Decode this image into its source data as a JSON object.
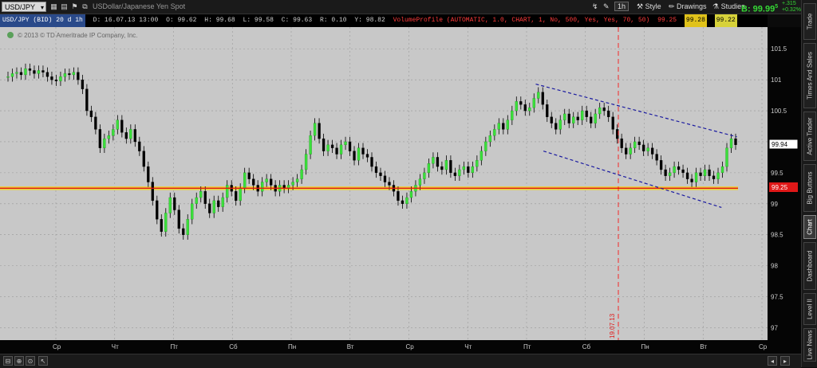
{
  "toolbar": {
    "symbol": "USD/JPY",
    "description": "USDollar/Japanese Yen Spot",
    "period": "1h",
    "style_label": "Style",
    "drawings_label": "Drawings",
    "studies_label": "Studies",
    "bid_label": "B: 99.99",
    "bid_superscript": "5",
    "change_pos": "+.315",
    "change_pct": "+0.32%"
  },
  "infobar": {
    "symbol_tag": "USD/JPY (BID) 20 d 1h",
    "date": "D: 16.07.13 13:00",
    "open": "O: 99.62",
    "high": "H: 99.68",
    "low": "L: 99.58",
    "close": "C: 99.63",
    "range": "R: 0.10",
    "y": "Y: 98.82",
    "volume_profile": "VolumeProfile (AUTOMATIC, 1.0, CHART, 1, No, 500, Yes, Yes, 70, 50)",
    "vp_value1": "99.25",
    "vp_value2": "99.28",
    "vp_value3": "99.22"
  },
  "copyright": "© 2013 © TD Ameritrade IP Company, Inc.",
  "sidebar_tabs": [
    "Trade",
    "Times And Sales",
    "Active Trader",
    "Big Buttons",
    "Chart",
    "Dashboard",
    "Level II",
    "Live News"
  ],
  "active_tab": "Chart",
  "price_labels": {
    "current": "99.94",
    "level": "99.25"
  },
  "vertical_line_label": "19.07.13",
  "colors": {
    "background": "#c8c8c8",
    "up": "#3ae03a",
    "down": "#000000",
    "grid": "#999999",
    "level_line": "#e01818",
    "channel": "#1a1aa0",
    "vline": "#ff0000"
  },
  "chart_data": {
    "type": "candlestick",
    "y_ticks": [
      101.5,
      101,
      100.5,
      100,
      99.5,
      99,
      98.5,
      98,
      97.5,
      97
    ],
    "ylim": [
      96.8,
      101.85
    ],
    "x_ticks": [
      "Ср",
      "Чт",
      "Пт",
      "Сб",
      "Пн",
      "Вт",
      "Ср",
      "Чт",
      "Пт",
      "Сб",
      "Пн",
      "Вт",
      "Ср"
    ],
    "horizontal_level": 99.25,
    "current_price": 99.94,
    "vertical_marker": "19.07.13",
    "channel": {
      "upper": [
        [
          0.698,
          100.93
        ],
        [
          0.96,
          100.08
        ]
      ],
      "lower": [
        [
          0.708,
          99.85
        ],
        [
          0.94,
          98.94
        ]
      ]
    },
    "closes": [
      101.05,
      101.1,
      101.12,
      101.08,
      101.18,
      101.15,
      101.1,
      101.15,
      101.12,
      101.05,
      101.0,
      100.98,
      101.05,
      101.1,
      101.08,
      101.12,
      101.0,
      100.85,
      100.5,
      100.4,
      100.2,
      99.9,
      100.05,
      100.1,
      100.2,
      100.35,
      100.15,
      100.05,
      100.2,
      100.0,
      99.85,
      99.6,
      99.35,
      99.05,
      98.75,
      98.55,
      98.85,
      99.1,
      98.9,
      98.6,
      98.5,
      98.75,
      99.0,
      99.1,
      99.2,
      99.0,
      98.85,
      99.05,
      98.95,
      99.1,
      99.3,
      99.2,
      99.05,
      99.25,
      99.5,
      99.4,
      99.3,
      99.2,
      99.35,
      99.4,
      99.3,
      99.2,
      99.3,
      99.25,
      99.3,
      99.35,
      99.4,
      99.55,
      99.8,
      100.1,
      100.3,
      100.05,
      99.85,
      99.95,
      99.9,
      99.8,
      99.95,
      100.0,
      99.85,
      99.7,
      99.9,
      99.8,
      99.75,
      99.6,
      99.5,
      99.45,
      99.35,
      99.3,
      99.2,
      99.05,
      99.0,
      99.1,
      99.2,
      99.3,
      99.4,
      99.5,
      99.65,
      99.75,
      99.6,
      99.55,
      99.7,
      99.5,
      99.45,
      99.55,
      99.6,
      99.5,
      99.6,
      99.7,
      99.85,
      100.0,
      100.1,
      100.2,
      100.3,
      100.2,
      100.35,
      100.5,
      100.65,
      100.6,
      100.5,
      100.55,
      100.7,
      100.8,
      100.6,
      100.4,
      100.3,
      100.2,
      100.35,
      100.45,
      100.3,
      100.4,
      100.35,
      100.5,
      100.4,
      100.3,
      100.45,
      100.55,
      100.5,
      100.4,
      100.2,
      100.05,
      99.9,
      99.8,
      99.9,
      100.0,
      99.95,
      99.85,
      99.9,
      99.8,
      99.7,
      99.55,
      99.45,
      99.5,
      99.6,
      99.55,
      99.5,
      99.4,
      99.35,
      99.5,
      99.45,
      99.55,
      99.45,
      99.4,
      99.5,
      99.6,
      99.9,
      100.05,
      99.95
    ]
  }
}
